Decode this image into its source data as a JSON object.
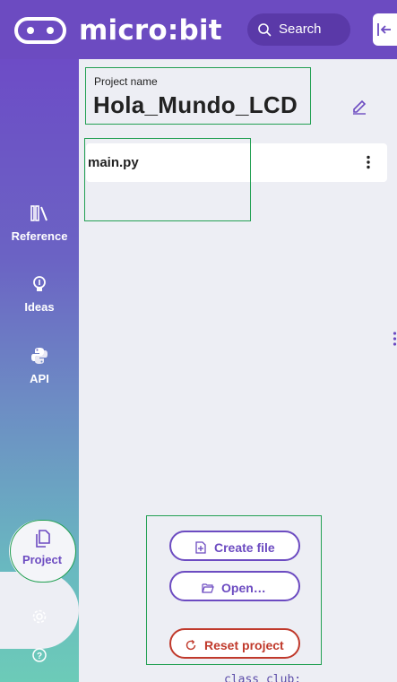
{
  "header": {
    "logo_text": "micro:bit",
    "search_label": "Search"
  },
  "sidebar": {
    "items": [
      {
        "label": "Reference"
      },
      {
        "label": "Ideas"
      },
      {
        "label": "API"
      },
      {
        "label": "Project"
      }
    ]
  },
  "project": {
    "name_label": "Project name",
    "name": "Hola_Mundo_LCD"
  },
  "files": [
    {
      "name": "main.py"
    }
  ],
  "actions": {
    "create_file": "Create file",
    "open": "Open…",
    "reset_project": "Reset project"
  },
  "code_peek": "class club:",
  "colors": {
    "brand": "#6c4bc1",
    "danger": "#c0392b",
    "highlight": "#23a053"
  }
}
